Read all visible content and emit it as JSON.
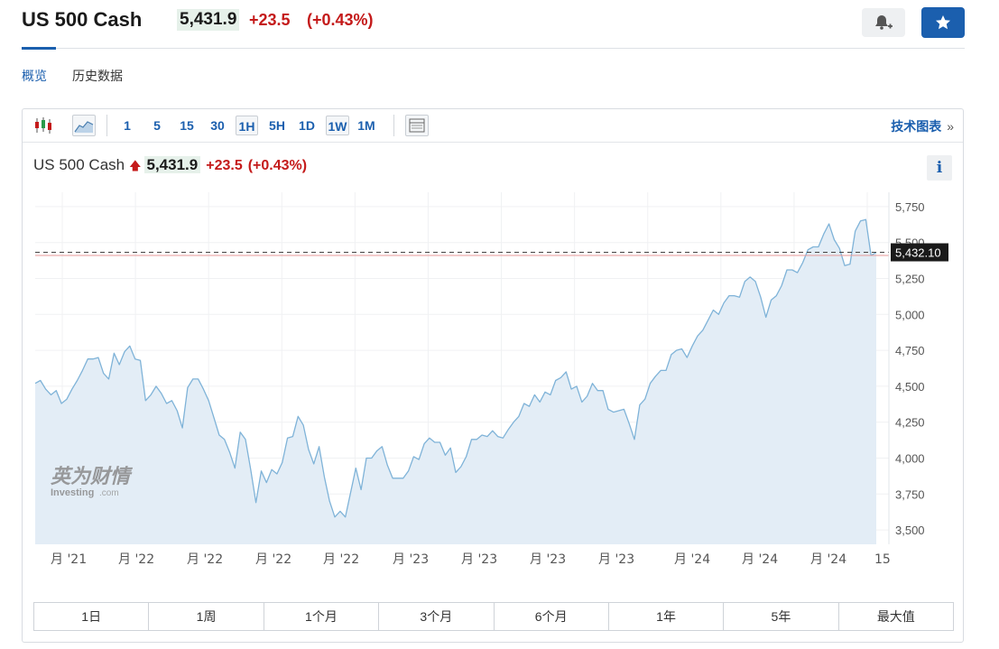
{
  "header": {
    "title": "US 500 Cash",
    "price": "5,431.9",
    "change": "+23.5",
    "change_pct": "(+0.43%)",
    "tabs": [
      "概览",
      "历史数据"
    ]
  },
  "toolbar": {
    "intervals": [
      "1",
      "5",
      "15",
      "30",
      "1H",
      "5H",
      "1D",
      "1W",
      "1M"
    ],
    "boxed_intervals": [
      "1H",
      "1W"
    ],
    "advanced_label": "技术图表",
    "advanced_chevron": "»",
    "icons": [
      "candlestick-icon",
      "area-chart-icon",
      "table-icon"
    ]
  },
  "legend": {
    "symbol": "US 500 Cash",
    "arrow": "🡅",
    "price": "5,431.9",
    "change": "+23.5",
    "change_pct": "(+0.43%)",
    "info_label": "i"
  },
  "watermark": {
    "cn": "英为财情",
    "en": "Investing",
    "en_suffix": ".com"
  },
  "colors": {
    "line": "#7fb3d8",
    "area": "#e3edf6",
    "up": "#c41a1a",
    "accent": "#1b5fae",
    "last_price_bg": "#1a1a1a"
  },
  "chart_data": {
    "type": "area",
    "title": "",
    "xlabel": "",
    "ylabel": "",
    "ylim": [
      3400,
      5850
    ],
    "y_ticks": [
      3500,
      3750,
      4000,
      4250,
      4500,
      4750,
      5000,
      5250,
      5500,
      5750
    ],
    "y_tick_labels": [
      "3,500",
      "3,750",
      "4,000",
      "4,250",
      "4,500",
      "4,750",
      "5,000",
      "5,250",
      "5,500",
      "5,750"
    ],
    "x_tick_labels": [
      "月 '21",
      "月 '22",
      "月 '22",
      "月 '22",
      "月 '22",
      "月 '23",
      "月 '23",
      "月 '23",
      "月 '23",
      "月 '24",
      "月 '24",
      "月 '24",
      "15"
    ],
    "last_price_label": "5,432.10",
    "last_price": 5432.1,
    "reference_level": 5410,
    "series": [
      {
        "values": [
          4520,
          4540,
          4480,
          4440,
          4470,
          4380,
          4410,
          4480,
          4540,
          4610,
          4690,
          4690,
          4700,
          4590,
          4550,
          4730,
          4650,
          4740,
          4780,
          4690,
          4680,
          4400,
          4440,
          4500,
          4450,
          4380,
          4400,
          4330,
          4210,
          4490,
          4550,
          4550,
          4480,
          4400,
          4280,
          4160,
          4130,
          4040,
          3930,
          4180,
          4130,
          3920,
          3690,
          3910,
          3830,
          3920,
          3890,
          3970,
          4140,
          4150,
          4290,
          4230,
          4060,
          3960,
          4080,
          3870,
          3700,
          3590,
          3630,
          3590,
          3760,
          3930,
          3780,
          4000,
          4000,
          4050,
          4080,
          3950,
          3860,
          3860,
          3860,
          3910,
          4010,
          3990,
          4100,
          4140,
          4110,
          4110,
          4020,
          4070,
          3900,
          3940,
          4010,
          4130,
          4130,
          4160,
          4150,
          4190,
          4150,
          4140,
          4200,
          4250,
          4290,
          4380,
          4360,
          4440,
          4390,
          4460,
          4440,
          4540,
          4560,
          4600,
          4480,
          4500,
          4390,
          4430,
          4520,
          4470,
          4470,
          4340,
          4320,
          4330,
          4340,
          4240,
          4130,
          4370,
          4410,
          4520,
          4570,
          4610,
          4610,
          4720,
          4750,
          4760,
          4700,
          4780,
          4850,
          4890,
          4960,
          5030,
          5000,
          5080,
          5130,
          5130,
          5120,
          5230,
          5260,
          5230,
          5120,
          4980,
          5100,
          5130,
          5200,
          5310,
          5310,
          5290,
          5360,
          5450,
          5470,
          5470,
          5560,
          5630,
          5520,
          5460,
          5340,
          5350,
          5580,
          5650,
          5660,
          5410,
          5432
        ]
      }
    ]
  },
  "ranges": [
    "1日",
    "1周",
    "1个月",
    "3个月",
    "6个月",
    "1年",
    "5年",
    "最大值"
  ]
}
